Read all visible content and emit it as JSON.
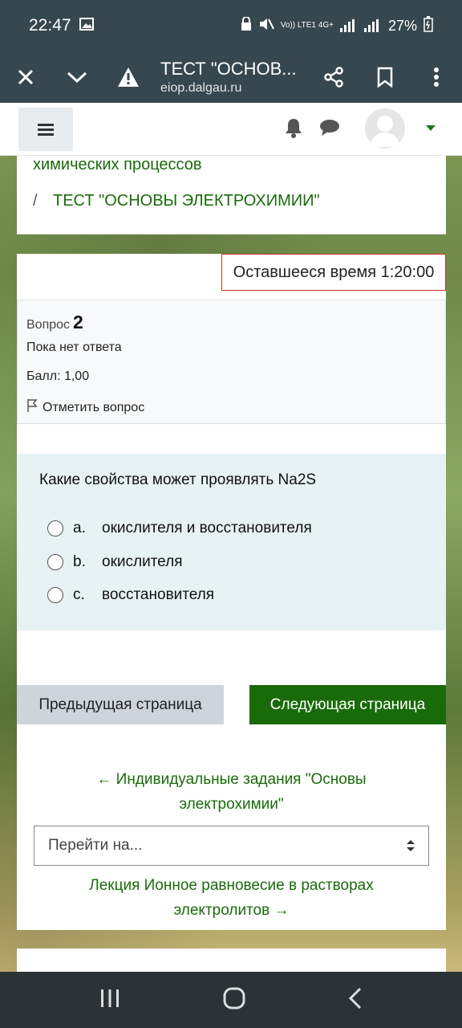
{
  "status_bar": {
    "time": "22:47",
    "network": "Vo)) LTE1 4G+",
    "battery": "27%"
  },
  "browser": {
    "title": "ТЕСТ \"ОСНОВ...",
    "url": "eiop.dalgau.ru"
  },
  "breadcrumb": {
    "parent": "химических процессов",
    "separator": "/",
    "current": "ТЕСТ \"ОСНОВЫ ЭЛЕКТРОХИМИИ\""
  },
  "timer": {
    "label": "Оставшееся время 1:20:00"
  },
  "question_info": {
    "label": "Вопрос",
    "number": "2",
    "status": "Пока нет ответа",
    "score": "Балл: 1,00",
    "flag": "Отметить вопрос"
  },
  "question": {
    "text": "Какие свойства может проявлять Na2S",
    "options": [
      {
        "letter": "a.",
        "text": "окислителя и восстановителя"
      },
      {
        "letter": "b.",
        "text": "окислителя"
      },
      {
        "letter": "c.",
        "text": "восстановителя"
      }
    ]
  },
  "buttons": {
    "prev": "Предыдущая страница",
    "next": "Следующая страница"
  },
  "navigation": {
    "prev_link_line1": "← Индивидуальные задания \"Основы",
    "prev_link_line2": "электрохимии\"",
    "jump_placeholder": "Перейти на...",
    "next_link_line1": "Лекция Ионное равновесие в растворах",
    "next_link_line2": "электролитов →"
  },
  "colors": {
    "accent": "#196b0a",
    "toolbar": "#37474f",
    "question_bg": "#e6f2f3",
    "timer_border": "#c0392b"
  },
  "icons": [
    "close-icon",
    "chevron-down-icon",
    "warning-icon",
    "share-icon",
    "bookmark-icon",
    "more-vert-icon",
    "bell-icon",
    "chat-icon",
    "avatar",
    "flag-icon",
    "updown-icon"
  ]
}
